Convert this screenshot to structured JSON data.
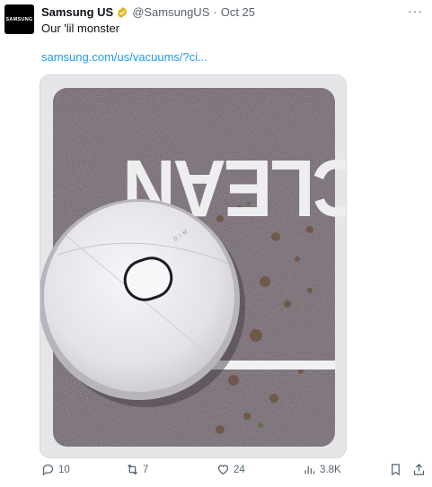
{
  "tweet": {
    "avatar_text": "SAMSUNG",
    "author_name": "Samsung US",
    "handle": "@SamsungUS",
    "separator": "·",
    "date": "Oct 25",
    "text": "Our 'lil monster",
    "link": "samsung.com/us/vacuums/?ci...",
    "more_label": "···"
  },
  "media": {
    "poster_word": "CLEAN",
    "device_brand": "DIM"
  },
  "actions": {
    "replies": "10",
    "reposts": "7",
    "likes": "24",
    "views": "3.8K"
  },
  "colors": {
    "accent": "#1d9bf0",
    "muted": "#536471",
    "verified_badge": "#e2b719"
  }
}
